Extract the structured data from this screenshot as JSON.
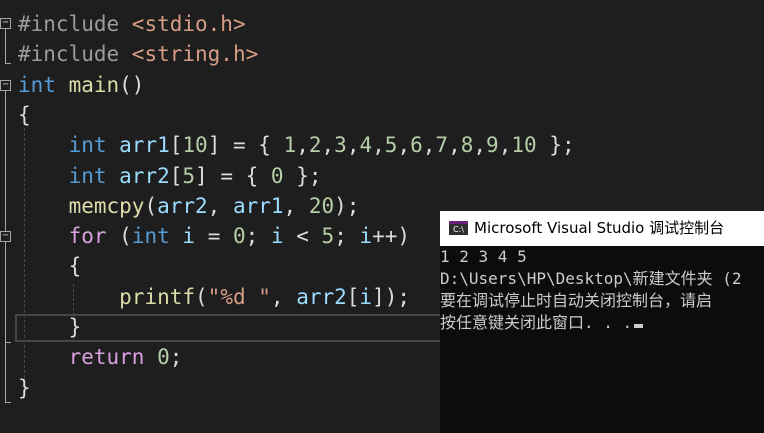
{
  "editor": {
    "lines": [
      {
        "parts": [
          {
            "t": "#include ",
            "c": "pp"
          },
          {
            "t": "<stdio.h>",
            "c": "hdr"
          }
        ]
      },
      {
        "parts": [
          {
            "t": "#include ",
            "c": "pp"
          },
          {
            "t": "<string.h>",
            "c": "hdr"
          }
        ]
      },
      {
        "parts": [
          {
            "t": "int ",
            "c": "kw"
          },
          {
            "t": "main",
            "c": "fn"
          },
          {
            "t": "()",
            "c": "punc"
          }
        ]
      },
      {
        "parts": [
          {
            "t": "{",
            "c": "punc"
          }
        ]
      },
      {
        "parts": [
          {
            "t": "    ",
            "c": "punc"
          },
          {
            "t": "int ",
            "c": "kw"
          },
          {
            "t": "arr1",
            "c": "var"
          },
          {
            "t": "[",
            "c": "punc"
          },
          {
            "t": "10",
            "c": "num"
          },
          {
            "t": "] = { ",
            "c": "punc"
          },
          {
            "t": "1",
            "c": "num"
          },
          {
            "t": ",",
            "c": "punc"
          },
          {
            "t": "2",
            "c": "num"
          },
          {
            "t": ",",
            "c": "punc"
          },
          {
            "t": "3",
            "c": "num"
          },
          {
            "t": ",",
            "c": "punc"
          },
          {
            "t": "4",
            "c": "num"
          },
          {
            "t": ",",
            "c": "punc"
          },
          {
            "t": "5",
            "c": "num"
          },
          {
            "t": ",",
            "c": "punc"
          },
          {
            "t": "6",
            "c": "num"
          },
          {
            "t": ",",
            "c": "punc"
          },
          {
            "t": "7",
            "c": "num"
          },
          {
            "t": ",",
            "c": "punc"
          },
          {
            "t": "8",
            "c": "num"
          },
          {
            "t": ",",
            "c": "punc"
          },
          {
            "t": "9",
            "c": "num"
          },
          {
            "t": ",",
            "c": "punc"
          },
          {
            "t": "10",
            "c": "num"
          },
          {
            "t": " };",
            "c": "punc"
          }
        ]
      },
      {
        "parts": [
          {
            "t": "    ",
            "c": "punc"
          },
          {
            "t": "int ",
            "c": "kw"
          },
          {
            "t": "arr2",
            "c": "var"
          },
          {
            "t": "[",
            "c": "punc"
          },
          {
            "t": "5",
            "c": "num"
          },
          {
            "t": "] = { ",
            "c": "punc"
          },
          {
            "t": "0",
            "c": "num"
          },
          {
            "t": " };",
            "c": "punc"
          }
        ]
      },
      {
        "parts": [
          {
            "t": "    ",
            "c": "punc"
          },
          {
            "t": "memcpy",
            "c": "fn"
          },
          {
            "t": "(",
            "c": "punc"
          },
          {
            "t": "arr2",
            "c": "var"
          },
          {
            "t": ", ",
            "c": "punc"
          },
          {
            "t": "arr1",
            "c": "var"
          },
          {
            "t": ", ",
            "c": "punc"
          },
          {
            "t": "20",
            "c": "num"
          },
          {
            "t": ");",
            "c": "punc"
          }
        ]
      },
      {
        "parts": [
          {
            "t": "    ",
            "c": "punc"
          },
          {
            "t": "for ",
            "c": "ctl"
          },
          {
            "t": "(",
            "c": "punc"
          },
          {
            "t": "int ",
            "c": "kw"
          },
          {
            "t": "i",
            "c": "var"
          },
          {
            "t": " = ",
            "c": "punc"
          },
          {
            "t": "0",
            "c": "num"
          },
          {
            "t": "; ",
            "c": "punc"
          },
          {
            "t": "i",
            "c": "var"
          },
          {
            "t": " < ",
            "c": "punc"
          },
          {
            "t": "5",
            "c": "num"
          },
          {
            "t": "; ",
            "c": "punc"
          },
          {
            "t": "i",
            "c": "var"
          },
          {
            "t": "++)",
            "c": "punc"
          }
        ]
      },
      {
        "parts": [
          {
            "t": "    {",
            "c": "punc"
          }
        ]
      },
      {
        "parts": [
          {
            "t": "        ",
            "c": "punc"
          },
          {
            "t": "printf",
            "c": "fn"
          },
          {
            "t": "(",
            "c": "punc"
          },
          {
            "t": "\"%d \"",
            "c": "str"
          },
          {
            "t": ", ",
            "c": "punc"
          },
          {
            "t": "arr2",
            "c": "var"
          },
          {
            "t": "[",
            "c": "punc"
          },
          {
            "t": "i",
            "c": "var"
          },
          {
            "t": "]);",
            "c": "punc"
          }
        ]
      },
      {
        "parts": [
          {
            "t": "    }",
            "c": "punc"
          }
        ]
      },
      {
        "parts": [
          {
            "t": "    ",
            "c": "punc"
          },
          {
            "t": "return ",
            "c": "ctl"
          },
          {
            "t": "0",
            "c": "num"
          },
          {
            "t": ";",
            "c": "punc"
          }
        ]
      },
      {
        "parts": [
          {
            "t": "}",
            "c": "punc"
          }
        ]
      }
    ]
  },
  "console": {
    "title": "Microsoft Visual Studio 调试控制台",
    "app_icon": "visual-studio-icon",
    "icon_text": "C:\\",
    "lines": [
      "1 2 3 4 5",
      "D:\\Users\\HP\\Desktop\\新建文件夹 (2",
      "要在调试停止时自动关闭控制台，请启",
      "按任意键关闭此窗口. . ."
    ]
  },
  "colors": {
    "keyword": "#569cd6",
    "function": "#dcdcaa",
    "number": "#b5cea8",
    "string": "#d69d85",
    "control": "#d8a0df",
    "background": "#1e1e1e",
    "console_background": "#0c0c0c"
  }
}
